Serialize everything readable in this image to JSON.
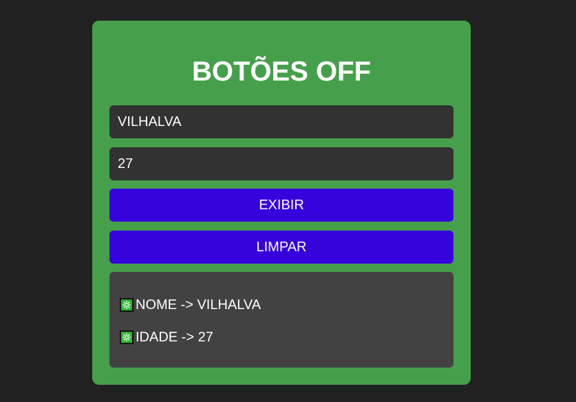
{
  "card": {
    "title": "BOTÕES OFF"
  },
  "form": {
    "name_value": "VILHALVA",
    "age_value": "27"
  },
  "buttons": {
    "show_label": "EXIBIR",
    "clear_label": "LIMPAR"
  },
  "output": {
    "lines": [
      {
        "icon": "sparkle-icon",
        "text": "NOME -> VILHALVA"
      },
      {
        "icon": "sparkle-icon",
        "text": "IDADE -> 27"
      }
    ]
  },
  "colors": {
    "page_background": "#212121",
    "card_background": "#46a04b",
    "field_background": "#323232",
    "button_background": "#3603dc",
    "output_background": "#424242",
    "sparkle_background": "#2bb52f",
    "text": "#ffffff"
  }
}
